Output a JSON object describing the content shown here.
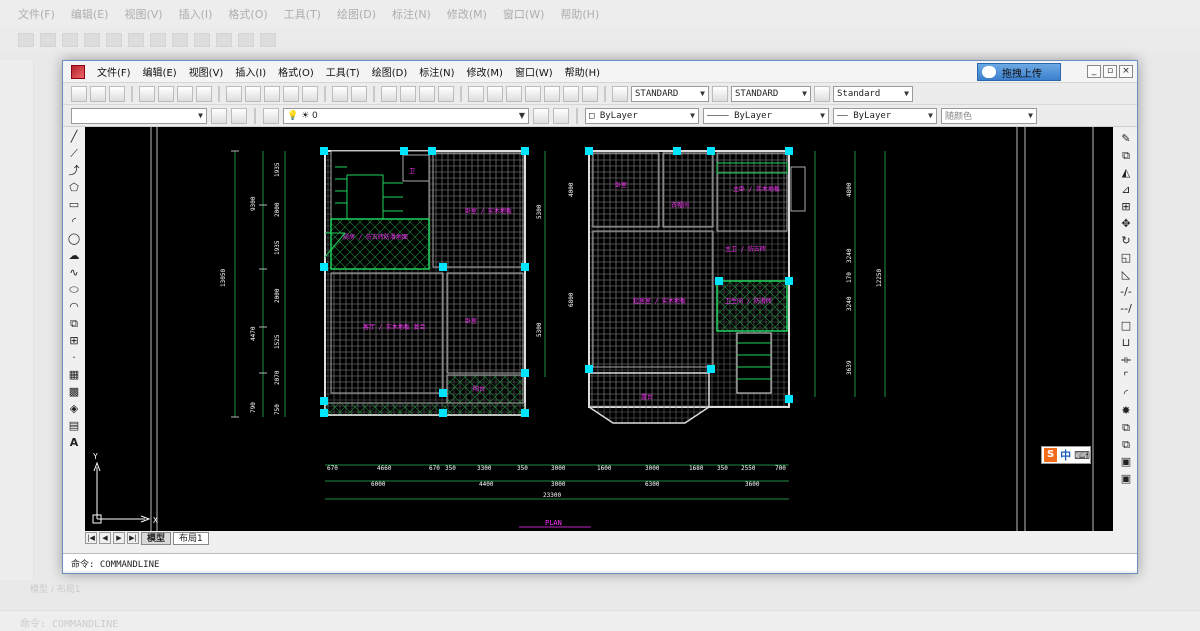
{
  "background": {
    "menu": [
      "文件(F)",
      "编辑(E)",
      "视图(V)",
      "插入(I)",
      "格式(O)",
      "工具(T)",
      "绘图(D)",
      "标注(N)",
      "修改(M)",
      "窗口(W)",
      "帮助(H)"
    ],
    "command": "命令: COMMANDLINE",
    "tabs": "模型 / 布局1"
  },
  "app": {
    "menu": [
      "文件(F)",
      "编辑(E)",
      "视图(V)",
      "插入(I)",
      "格式(O)",
      "工具(T)",
      "绘图(D)",
      "标注(N)",
      "修改(M)",
      "窗口(W)",
      "帮助(H)"
    ],
    "upload_label": "拖拽上传",
    "text_style": "STANDARD",
    "dim_style": "STANDARD",
    "table_style": "Standard",
    "layer": "0",
    "color": "ByLayer",
    "linetype": "ByLayer",
    "lineweight": "ByLayer",
    "plot_style": "随颜色",
    "tabs": [
      "模型",
      "布局1"
    ],
    "command": "命令: COMMANDLINE",
    "ime": "中"
  },
  "drawing": {
    "title": "PLAN",
    "dims_bottom_top": [
      "670",
      "4660",
      "670",
      "350",
      "3300",
      "350",
      "3000",
      "1600",
      "3000",
      "1680",
      "350",
      "2550",
      "700"
    ],
    "dims_bottom_mid": [
      "6000",
      "4400",
      "3000",
      "6300",
      "3600"
    ],
    "dims_bottom_total": "23300",
    "dims_left_outer": "13050",
    "dims_left": [
      "9300",
      "1935",
      "2000",
      "1935",
      "2000",
      "4470",
      "1525",
      "2070",
      "790",
      "750"
    ],
    "dims_right_a": [
      "5300",
      "5300"
    ],
    "dims_right_b": [
      "4000",
      "6800"
    ],
    "dims_right_c": [
      "4800",
      "3240",
      "170",
      "3240",
      "3639",
      "12250"
    ],
    "accent_color": "#00e5ff",
    "label_color": "#ff33ff"
  }
}
